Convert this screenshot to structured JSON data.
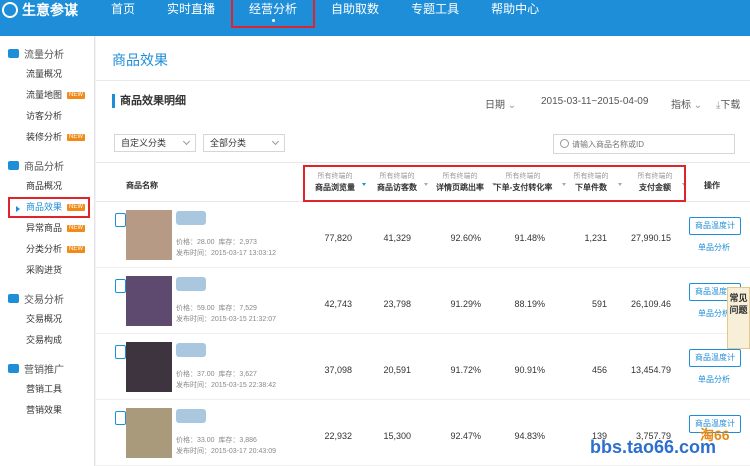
{
  "brand": {
    "name": "生意参谋"
  },
  "nav": [
    {
      "label": "首页"
    },
    {
      "label": "实时直播"
    },
    {
      "label": "经营分析",
      "active": true
    },
    {
      "label": "自助取数"
    },
    {
      "label": "专题工具"
    },
    {
      "label": "帮助中心"
    }
  ],
  "sidebar": {
    "sections": [
      {
        "title": "流量分析",
        "icon": "eye-icon",
        "items": [
          {
            "label": "流量概况"
          },
          {
            "label": "流量地图",
            "badge": "NEW"
          },
          {
            "label": "访客分析"
          },
          {
            "label": "装修分析",
            "badge": "NEW"
          }
        ]
      },
      {
        "title": "商品分析",
        "icon": "box-icon",
        "items": [
          {
            "label": "商品概况"
          },
          {
            "label": "商品效果",
            "badge": "NEW",
            "active": true
          },
          {
            "label": "异常商品",
            "badge": "NEW"
          },
          {
            "label": "分类分析",
            "badge": "NEW"
          },
          {
            "label": "采购进货"
          }
        ]
      },
      {
        "title": "交易分析",
        "icon": "cart-icon",
        "items": [
          {
            "label": "交易概况"
          },
          {
            "label": "交易构成"
          }
        ]
      },
      {
        "title": "营销推广",
        "icon": "megaphone-icon",
        "items": [
          {
            "label": "营销工具"
          },
          {
            "label": "营销效果"
          }
        ]
      }
    ]
  },
  "main": {
    "title": "商品效果",
    "section": "商品效果明细",
    "date_label": "日期",
    "date_range": "2015-03-11~2015-04-09",
    "metric_label": "指标",
    "download_label": "下载",
    "filter1": "自定义分类",
    "filter2": "全部分类",
    "search_placeholder": "请输入商品名称或ID",
    "columns": {
      "name": "商品名称",
      "sub": "所有终端的",
      "pv": "商品浏览量",
      "uv": "商品访客数",
      "bounce": "详情页跳出率",
      "conv": "下单-支付转化率",
      "orders": "下单件数",
      "amount": "支付金额",
      "op": "操作"
    },
    "rows": [
      {
        "price": "价格：28.00",
        "stock": "库存：2,973",
        "time": "发布时间：2015-03-17 13:03:12",
        "pv": "77,820",
        "uv": "41,329",
        "bounce": "92.60%",
        "conv": "91.48%",
        "orders": "1,231",
        "amount": "27,990.15"
      },
      {
        "price": "价格：59.00",
        "stock": "库存：7,529",
        "time": "发布时间：2015-03-15 21:32:07",
        "pv": "42,743",
        "uv": "23,798",
        "bounce": "91.29%",
        "conv": "88.19%",
        "orders": "591",
        "amount": "26,109.46"
      },
      {
        "price": "价格：37.00",
        "stock": "库存：3,627",
        "time": "发布时间：2015-03-15 22:38:42",
        "pv": "37,098",
        "uv": "20,591",
        "bounce": "91.72%",
        "conv": "90.91%",
        "orders": "456",
        "amount": "13,454.79"
      },
      {
        "price": "价格：33.00",
        "stock": "库存：3,886",
        "time": "发布时间：2015-03-17 20:43:09",
        "pv": "22,932",
        "uv": "15,300",
        "bounce": "92.47%",
        "conv": "94.83%",
        "orders": "139",
        "amount": "3,757.79"
      }
    ],
    "btn_temp": "商品温度计",
    "btn_analysis": "单品分析"
  },
  "faq": "常见问题",
  "watermark": "bbs.tao66.com",
  "watermark_logo": "淘66"
}
